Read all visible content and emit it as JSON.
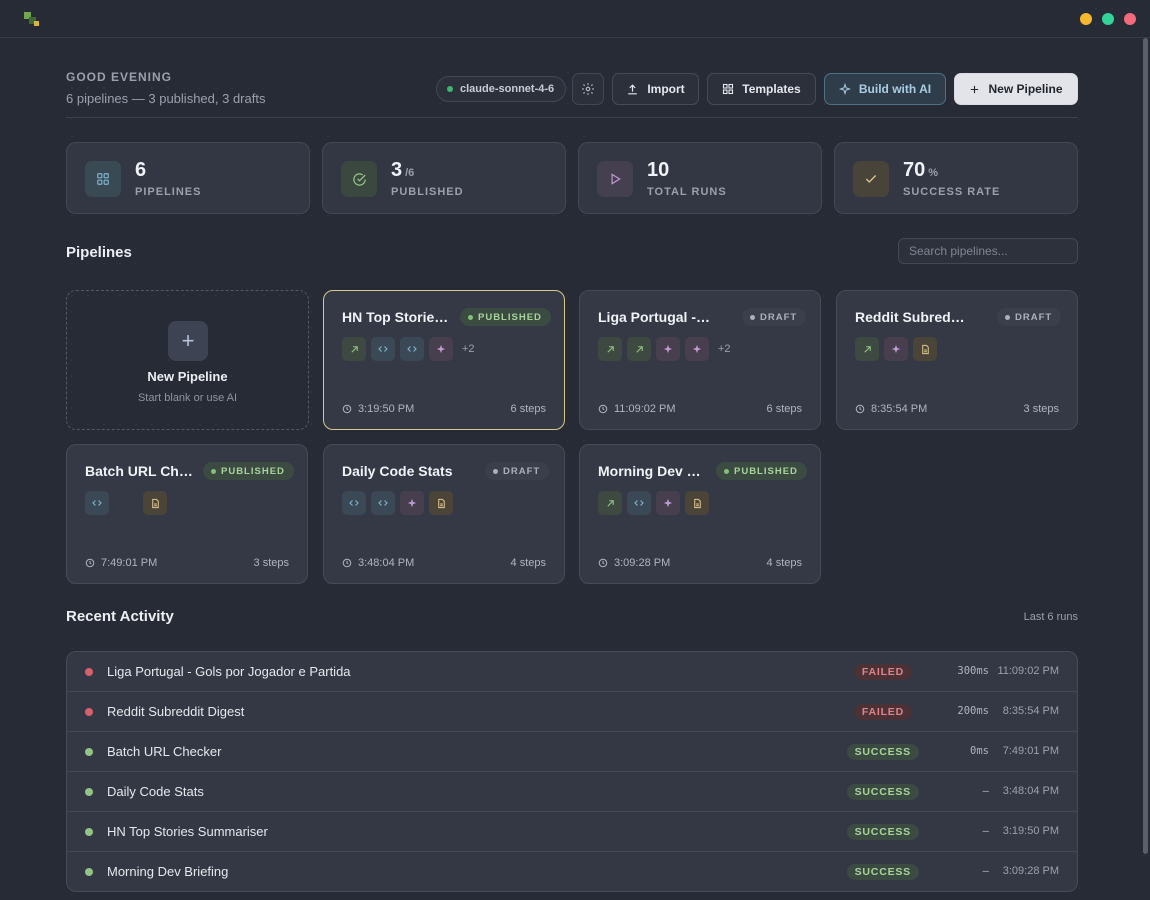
{
  "header": {
    "greeting": "GOOD EVENING",
    "subtitle": "6 pipelines — 3 published, 3 drafts",
    "model": "claude-sonnet-4-6",
    "buttons": {
      "import": "Import",
      "templates": "Templates",
      "build_ai": "Build with AI",
      "new_pipeline": "New Pipeline"
    }
  },
  "stats": [
    {
      "value": "6",
      "suffix": "",
      "label": "PIPELINES",
      "icon": "grid-icon"
    },
    {
      "value": "3",
      "suffix": "/6",
      "label": "PUBLISHED",
      "icon": "check-circle-icon"
    },
    {
      "value": "10",
      "suffix": "",
      "label": "TOTAL RUNS",
      "icon": "play-icon"
    },
    {
      "value": "70",
      "suffix": "%",
      "label": "SUCCESS RATE",
      "icon": "checkmark-icon"
    }
  ],
  "pipelines_section": {
    "title": "Pipelines",
    "search_placeholder": "Search pipelines...",
    "new_card": {
      "title": "New Pipeline",
      "subtitle": "Start blank or use AI"
    }
  },
  "pipelines": [
    {
      "name": "HN Top Stories Summariser",
      "status": "PUBLISHED",
      "steps_icons": [
        "arrow",
        "code",
        "code",
        "ai"
      ],
      "more": "+2",
      "time": "3:19:50 PM",
      "steps": "6 steps"
    },
    {
      "name": "Liga Portugal - Gols por Jogador e Partida",
      "status": "DRAFT",
      "steps_icons": [
        "arrow",
        "arrow",
        "ai",
        "ai"
      ],
      "more": "+2",
      "time": "11:09:02 PM",
      "steps": "6 steps"
    },
    {
      "name": "Reddit Subreddit Digest",
      "status": "DRAFT",
      "steps_icons": [
        "arrow",
        "ai",
        "doc"
      ],
      "more": "",
      "time": "8:35:54 PM",
      "steps": "3 steps"
    },
    {
      "name": "Batch URL Checker",
      "status": "PUBLISHED",
      "steps_icons": [
        "code",
        "gap",
        "doc"
      ],
      "more": "",
      "time": "7:49:01 PM",
      "steps": "3 steps"
    },
    {
      "name": "Daily Code Stats",
      "status": "DRAFT",
      "steps_icons": [
        "code",
        "code",
        "ai",
        "doc"
      ],
      "more": "",
      "time": "3:48:04 PM",
      "steps": "4 steps"
    },
    {
      "name": "Morning Dev Briefing",
      "status": "PUBLISHED",
      "steps_icons": [
        "arrow",
        "code",
        "ai",
        "doc"
      ],
      "more": "",
      "time": "3:09:28 PM",
      "steps": "4 steps"
    }
  ],
  "activity": {
    "title": "Recent Activity",
    "meta": "Last 6 runs",
    "rows": [
      {
        "name": "Liga Portugal - Gols por Jogador e Partida",
        "status": "FAILED",
        "duration": "300ms",
        "time": "11:09:02 PM"
      },
      {
        "name": "Reddit Subreddit Digest",
        "status": "FAILED",
        "duration": "200ms",
        "time": "8:35:54 PM"
      },
      {
        "name": "Batch URL Checker",
        "status": "SUCCESS",
        "duration": "0ms",
        "time": "7:49:01 PM"
      },
      {
        "name": "Daily Code Stats",
        "status": "SUCCESS",
        "duration": "–",
        "time": "3:48:04 PM"
      },
      {
        "name": "HN Top Stories Summariser",
        "status": "SUCCESS",
        "duration": "–",
        "time": "3:19:50 PM"
      },
      {
        "name": "Morning Dev Briefing",
        "status": "SUCCESS",
        "duration": "–",
        "time": "3:09:28 PM"
      }
    ]
  },
  "colors": {
    "background": "#272b35",
    "published": "#a8d49b",
    "failed": "#e0838a",
    "accent_ai": "#a9cde3",
    "selected_border": "#d8c98a",
    "window_minimize": "#f5b82e",
    "window_maximize": "#34d399",
    "window_close": "#f16b7c"
  }
}
